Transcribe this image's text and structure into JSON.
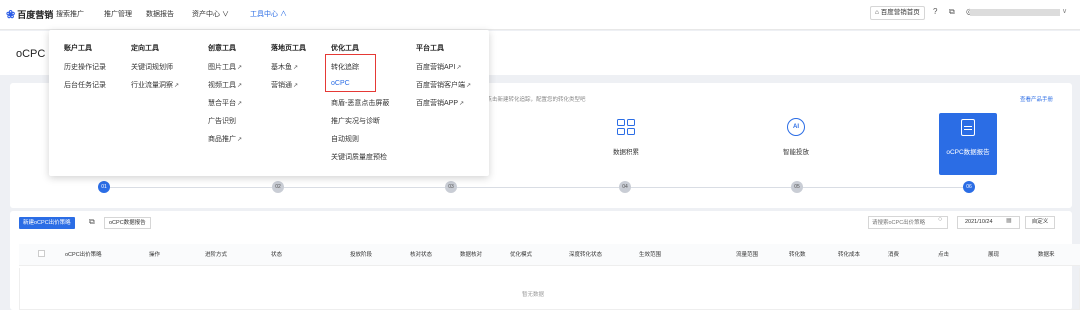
{
  "brand": {
    "name": "百度营销",
    "product": "搜索推广"
  },
  "topnav": {
    "items": [
      {
        "label": "推广管理",
        "active": false
      },
      {
        "label": "数据报告",
        "active": false
      },
      {
        "label": "资产中心 ∨",
        "active": false
      },
      {
        "label": "工具中心 ∧",
        "active": true
      }
    ],
    "home_button": "百度营销首页",
    "user_caret": "∨"
  },
  "page": {
    "title": "oCPC"
  },
  "dropdown": {
    "columns": [
      {
        "title": "账户工具",
        "items": [
          {
            "label": "历史操作记录",
            "ext": false
          },
          {
            "label": "后台任务记录",
            "ext": false
          }
        ]
      },
      {
        "title": "定向工具",
        "items": [
          {
            "label": "关键词规划师",
            "ext": false
          },
          {
            "label": "行业流量洞察",
            "ext": true
          }
        ]
      },
      {
        "title": "创意工具",
        "items": [
          {
            "label": "图片工具",
            "ext": true
          },
          {
            "label": "视频工具",
            "ext": true
          },
          {
            "label": "慧合平台",
            "ext": true
          },
          {
            "label": "广告识别",
            "ext": false
          },
          {
            "label": "商品推广",
            "ext": true
          }
        ]
      },
      {
        "title": "落地页工具",
        "items": [
          {
            "label": "基木鱼",
            "ext": true
          },
          {
            "label": "营销通",
            "ext": true
          }
        ]
      },
      {
        "title": "优化工具",
        "items": [
          {
            "label": "转化追踪",
            "ext": false
          },
          {
            "label": "oCPC",
            "ext": false
          },
          {
            "label": "商盾-恶意点击屏蔽",
            "ext": false
          },
          {
            "label": "推广实况与诊断",
            "ext": false
          },
          {
            "label": "自动规则",
            "ext": false
          },
          {
            "label": "关键词质量度预检",
            "ext": false
          }
        ]
      },
      {
        "title": "平台工具",
        "items": [
          {
            "label": "百度营销API",
            "ext": true
          },
          {
            "label": "百度营销客户端",
            "ext": true
          },
          {
            "label": "百度营销APP",
            "ext": true
          }
        ]
      }
    ]
  },
  "setup": {
    "hint": "，点击新建转化追踪，配置您的转化类型吧",
    "manual_link": "查看产品手册",
    "steps": [
      {
        "label": "数据积累",
        "icon": "grid-icon"
      },
      {
        "label": "智能投放",
        "icon": "ai-icon"
      },
      {
        "label": "oCPC数据报告",
        "icon": "report-icon"
      }
    ],
    "dots": [
      "01",
      "02",
      "03",
      "04",
      "05",
      "06"
    ]
  },
  "toolbar": {
    "new_button": "新建oCPC出价策略",
    "report_button": "oCPC数据报告",
    "search_placeholder": "请搜索oCPC出价策略",
    "date": "2021/10/24",
    "custom_button": "自定义"
  },
  "table": {
    "columns": [
      "oCPC出价策略",
      "操作",
      "进阶方式",
      "状态",
      "投放阶段",
      "核对状态",
      "数据核对",
      "优化模式",
      "深度转化状态",
      "生效范围",
      "流量范围",
      "转化数",
      "转化成本",
      "消费",
      "点击",
      "展现",
      "数据来"
    ],
    "empty_text": "暂无数据"
  }
}
